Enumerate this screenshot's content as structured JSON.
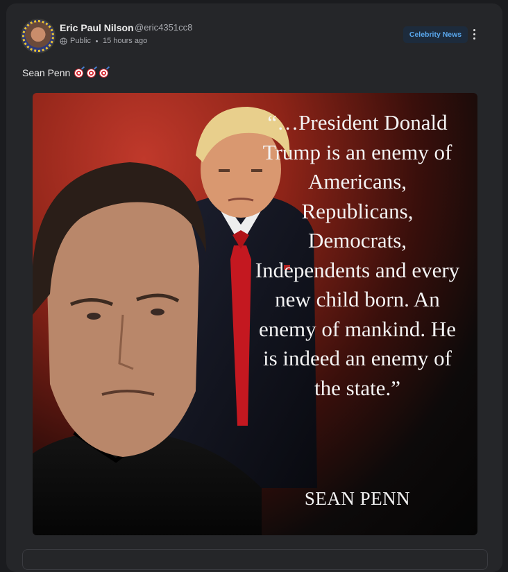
{
  "post": {
    "author_name": "Eric Paul Nilson",
    "author_handle": "@eric4351cc8",
    "visibility": "Public",
    "timestamp": "15 hours ago",
    "category_badge": "Celebrity News",
    "text": "Sean Penn"
  },
  "image": {
    "quote": "“…President Donald Trump is an enemy of Americans, Republicans, Democrats, Independents and every new child born. An enemy of mankind. He is indeed an enemy of the state.”",
    "attribution": "SEAN PENN"
  },
  "colors": {
    "card_bg": "#252629",
    "badge_text": "#5aa8ee",
    "badge_bg": "#1d2b3c"
  }
}
